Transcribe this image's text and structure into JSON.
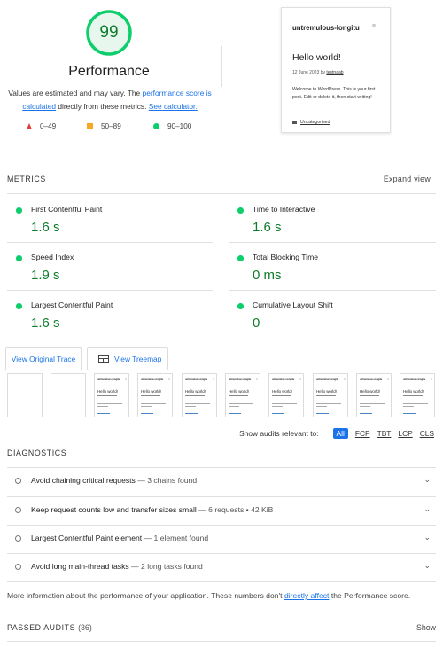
{
  "score": {
    "value": "99",
    "title": "Performance",
    "desc_before": "Values are estimated and may vary. The ",
    "desc_link1": "performance score is calculated",
    "desc_middle": " directly from these metrics. ",
    "desc_link2": "See calculator."
  },
  "legend": {
    "fail": "0–49",
    "average": "50–89",
    "pass": "90–100"
  },
  "screenshot": {
    "site_title": "untremulous-longitu",
    "menu_icon": "≡",
    "post_title": "Hello world!",
    "meta_date": "12 June 2023 by ",
    "meta_author": "testnaab",
    "body": "Welcome to WordPress. This is your first post. Edit or delete it, then start writing!",
    "category": "Uncategorised"
  },
  "metrics_section": {
    "label": "METRICS",
    "expand": "Expand view",
    "items": [
      {
        "label": "First Contentful Paint",
        "value": "1.6 s"
      },
      {
        "label": "Time to Interactive",
        "value": "1.6 s"
      },
      {
        "label": "Speed Index",
        "value": "1.9 s"
      },
      {
        "label": "Total Blocking Time",
        "value": "0 ms"
      },
      {
        "label": "Largest Contentful Paint",
        "value": "1.6 s"
      },
      {
        "label": "Cumulative Layout Shift",
        "value": "0"
      }
    ]
  },
  "buttons": {
    "trace": "View Original Trace",
    "treemap": "View Treemap"
  },
  "filmstrip": {
    "frame_site": "untremulous-longitu",
    "frame_title": "Hello world!"
  },
  "filter": {
    "label": "Show audits relevant to:",
    "chips": [
      "All",
      "FCP",
      "TBT",
      "LCP",
      "CLS"
    ]
  },
  "diagnostics": {
    "label": "DIAGNOSTICS",
    "items": [
      {
        "title": "Avoid chaining critical requests",
        "detail": "3 chains found"
      },
      {
        "title": "Keep request counts low and transfer sizes small",
        "detail": "6 requests • 42 KiB"
      },
      {
        "title": "Largest Contentful Paint element",
        "detail": "1 element found"
      },
      {
        "title": "Avoid long main-thread tasks",
        "detail": "2 long tasks found"
      }
    ],
    "separator": " — ",
    "info_before": "More information about the performance of your application. These numbers don't ",
    "info_link": "directly affect",
    "info_after": " the Performance score."
  },
  "passed": {
    "label": "PASSED AUDITS",
    "count": "(36)",
    "show": "Show"
  },
  "colors": {
    "pass": "#0cce6b",
    "pass_text": "#0c7c2b",
    "average": "#f9a825",
    "fail": "#e53935",
    "link": "#1a73e8"
  }
}
